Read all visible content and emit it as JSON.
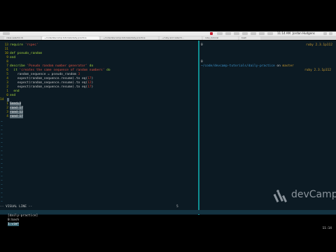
{
  "menubar": {
    "clock": "11:14 AM",
    "user": "Jordan Hudgens"
  },
  "tabs": [
    {
      "label": "class selector.rb"
    },
    {
      "label": "~/code/devcamp-tutorials/daily-practice"
    },
    {
      "label": "~/code/devcamp-tutorials/daily-practice"
    },
    {
      "label": "~/ruby and rails/ch..."
    },
    {
      "label": "ruby_tutorial"
    },
    {
      "label": "bash"
    }
  ],
  "editor": {
    "lines": [
      {
        "n": "13",
        "a": "require ",
        "b": "'rspec'",
        "c": ""
      },
      {
        "n": "11",
        "a": "",
        "b": "",
        "c": ""
      },
      {
        "n": "10",
        "a": "def pseudo_random",
        "b": "",
        "c": ""
      },
      {
        "n": "9",
        "a": "end",
        "b": "",
        "c": ""
      },
      {
        "n": "8",
        "a": "",
        "b": "",
        "c": ""
      },
      {
        "n": "7",
        "a": "describe ",
        "b": "'Pseudo random number generator'",
        "c": " do"
      },
      {
        "n": "6",
        "a": "  it ",
        "b": "'creates the same sequence of random numbers'",
        "c": " do"
      },
      {
        "n": "5",
        "a": "    random_sequence = pseudo_random ",
        "b": "3",
        "c": ""
      },
      {
        "n": "4",
        "a": "    expect(random_sequence.resume).to eq(",
        "b": "17",
        "c": ")"
      },
      {
        "n": "3",
        "a": "    expect(random_sequence.resume).to eq(",
        "b": "12",
        "c": ")"
      },
      {
        "n": "2",
        "a": "    expect(random_sequence.resume).to eq(",
        "b": "17",
        "c": ")"
      },
      {
        "n": "1",
        "a": "  end",
        "b": "",
        "c": ""
      },
      {
        "n": "0",
        "a": "end",
        "b": "",
        "c": ""
      },
      {
        "n": "14",
        "a": "",
        "b": "",
        "c": ""
      }
    ],
    "selected": [
      {
        "n": "1",
        "text": "Seed=3"
      },
      {
        "n": "2",
        "text": "rand 17"
      },
      {
        "n": "3",
        "text": "rand 12"
      },
      {
        "n": "4",
        "text": "rand 17"
      }
    ],
    "mode": "-- VISUAL LINE --",
    "sel_count": "5"
  },
  "right_pane": {
    "lines": [
      {
        "text": "0"
      },
      {
        "text": "0"
      }
    ],
    "prompt_path": "~/code/devcamp-tutorials/daily-practice",
    "prompt_on": " on ",
    "prompt_branch": "master",
    "ruby_version": "ruby 2.3.1p112"
  },
  "tmux": {
    "session": "[daily-practice]",
    "window0": "0:bash",
    "window1": "1:vim*",
    "clock": "11:14"
  },
  "watermark": {
    "text": "devCamp"
  }
}
